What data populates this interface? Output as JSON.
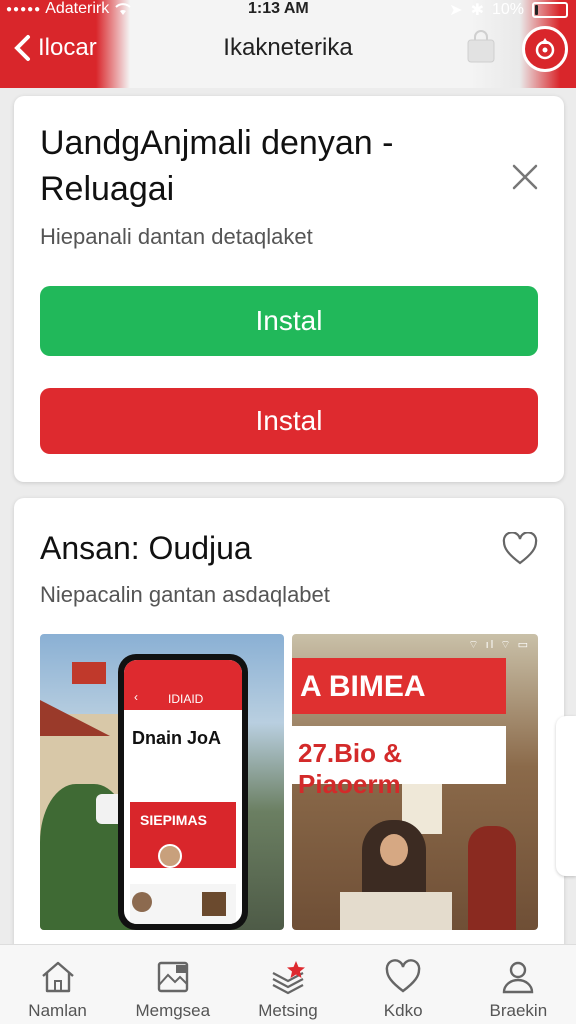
{
  "status": {
    "carrier": "Adaterirk",
    "time": "1:13 AM",
    "battery": "10%",
    "battery_level": 0.1
  },
  "nav": {
    "back_label": "Ilocar",
    "title": "Ikakneterika"
  },
  "card1": {
    "title": "UandgAnjmali denyan - Reluagai",
    "subtitle": "Hiepanali dantan detaqlaket",
    "button_primary": "Instal",
    "button_secondary": "Instal"
  },
  "card2": {
    "title": "Ansan: Oudjua",
    "subtitle": "Niepacalin gantan asdaqlabet",
    "shot1": {
      "phone_title": "IDIAID",
      "brand": "Dnain JoA",
      "banner": "SIEPIMAS"
    },
    "shot2": {
      "banner": "A BIMEA",
      "subbanner": "27.Bio & Piaoerm"
    }
  },
  "bottom_nav": [
    {
      "label": "Namlan",
      "icon": "home-icon"
    },
    {
      "label": "Memgsea",
      "icon": "gallery-icon"
    },
    {
      "label": "Metsing",
      "icon": "stack-star-icon"
    },
    {
      "label": "Kdko",
      "icon": "heart-icon"
    },
    {
      "label": "Braekin",
      "icon": "profile-icon"
    }
  ],
  "colors": {
    "brand_red": "#d9262b",
    "install_green": "#21b85a",
    "install_red": "#de2a2f"
  }
}
